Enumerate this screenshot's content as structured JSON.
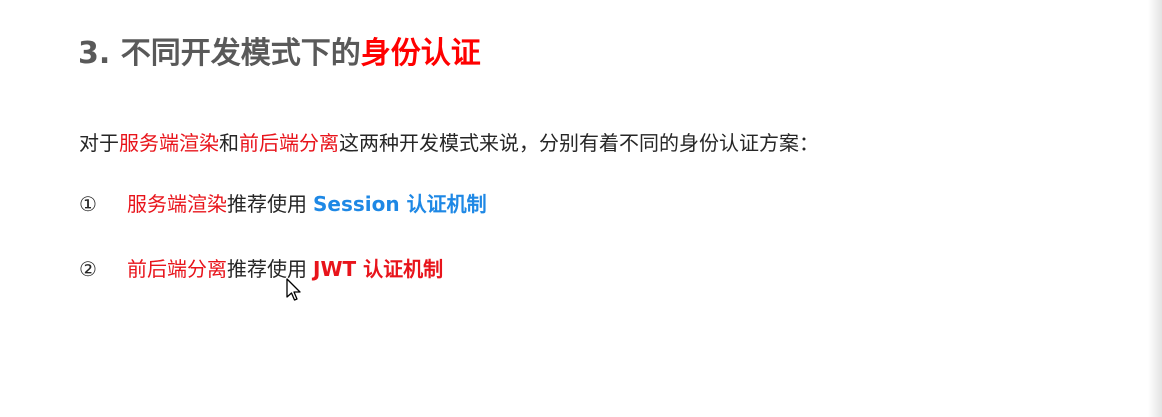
{
  "title": {
    "prefix": "3. 不同开发模式下的",
    "highlight": "身份认证"
  },
  "intro": {
    "part1": "对于",
    "term1": "服务端渲染",
    "part2": "和",
    "term2": "前后端分离",
    "part3": "这两种开发模式来说，分别有着不同的身份认证方案："
  },
  "items": [
    {
      "number": "①",
      "term": "服务端渲染",
      "middle": "推荐使用",
      "tech": "Session 认证机制"
    },
    {
      "number": "②",
      "term": "前后端分离",
      "middle": "推荐使用",
      "tech": "JWT 认证机制"
    }
  ],
  "colors": {
    "title_text": "#595959",
    "title_highlight": "#ff0000",
    "term_red": "#e8141b",
    "session_blue": "#1e88e5",
    "jwt_red": "#e8141b"
  },
  "icons": {
    "cursor": "mouse-pointer-icon"
  }
}
